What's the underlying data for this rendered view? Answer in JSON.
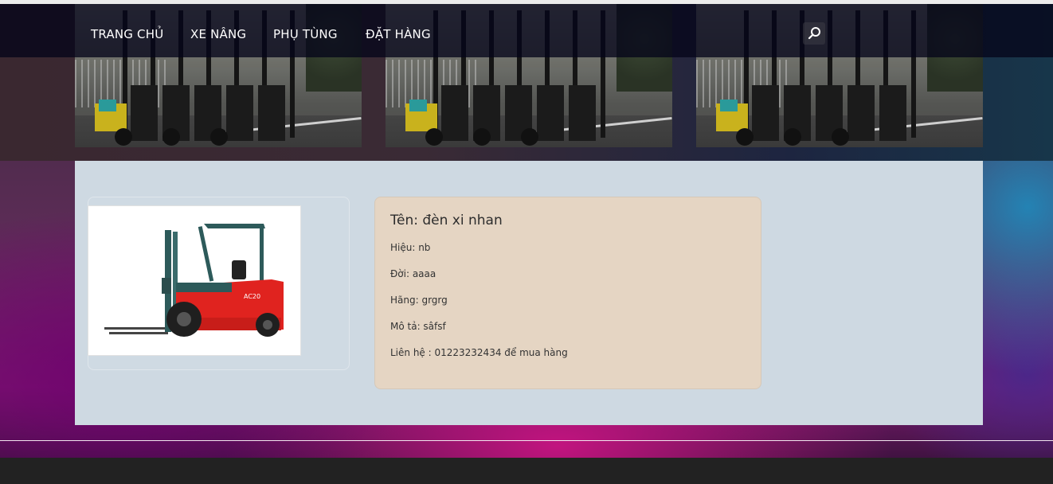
{
  "nav": {
    "items": [
      {
        "label": "TRANG CHỦ"
      },
      {
        "label": "XE NÂNG"
      },
      {
        "label": "PHỤ TÙNG"
      },
      {
        "label": "ĐẶT HÀNG"
      }
    ],
    "search_icon": "search-icon"
  },
  "product": {
    "image_icon": "forklift-image",
    "title": "Tên: đèn xi nhan",
    "brand": "Hiệu: nb",
    "year": "Đời: aaaa",
    "maker": "Hãng: grgrg",
    "description": "Mô tả: sâfsf",
    "contact": "Liên hệ : 01223232434 để mua hàng"
  },
  "colors": {
    "nav_bg": "#050519",
    "content_bg": "#ced9e2",
    "info_card_bg": "#e5d5c3",
    "footer_bg": "#222222",
    "forklift_red": "#e0231f"
  }
}
